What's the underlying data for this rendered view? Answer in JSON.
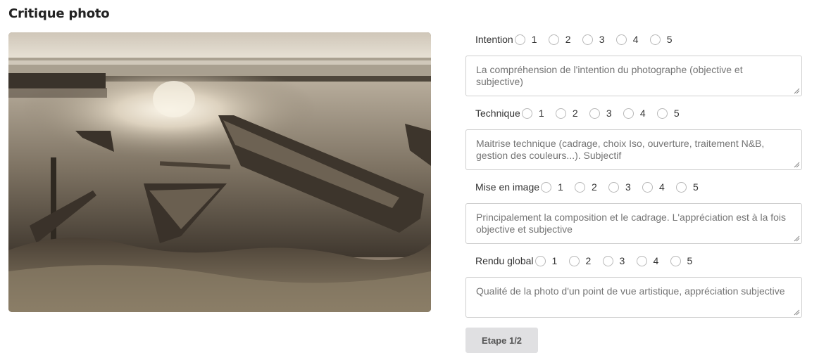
{
  "page": {
    "title": "Critique photo"
  },
  "photo": {
    "alt": ""
  },
  "criteria": [
    {
      "label": "Intention",
      "options": [
        "1",
        "2",
        "3",
        "4",
        "5"
      ],
      "placeholder": "La compréhension de l'intention du photographe (objective et subjective)"
    },
    {
      "label": "Technique",
      "options": [
        "1",
        "2",
        "3",
        "4",
        "5"
      ],
      "placeholder": "Maitrise technique (cadrage, choix Iso, ouverture, traitement N&B, gestion des couleurs...). Subjectif"
    },
    {
      "label": "Mise en image",
      "options": [
        "1",
        "2",
        "3",
        "4",
        "5"
      ],
      "placeholder": "Principalement la composition et le cadrage. L'appréciation est à la fois objective et subjective"
    },
    {
      "label": "Rendu global",
      "options": [
        "1",
        "2",
        "3",
        "4",
        "5"
      ],
      "placeholder": "Qualité de la photo d'un point de vue artistique, appréciation subjective"
    }
  ],
  "actions": {
    "step_label": "Etape 1/2"
  }
}
